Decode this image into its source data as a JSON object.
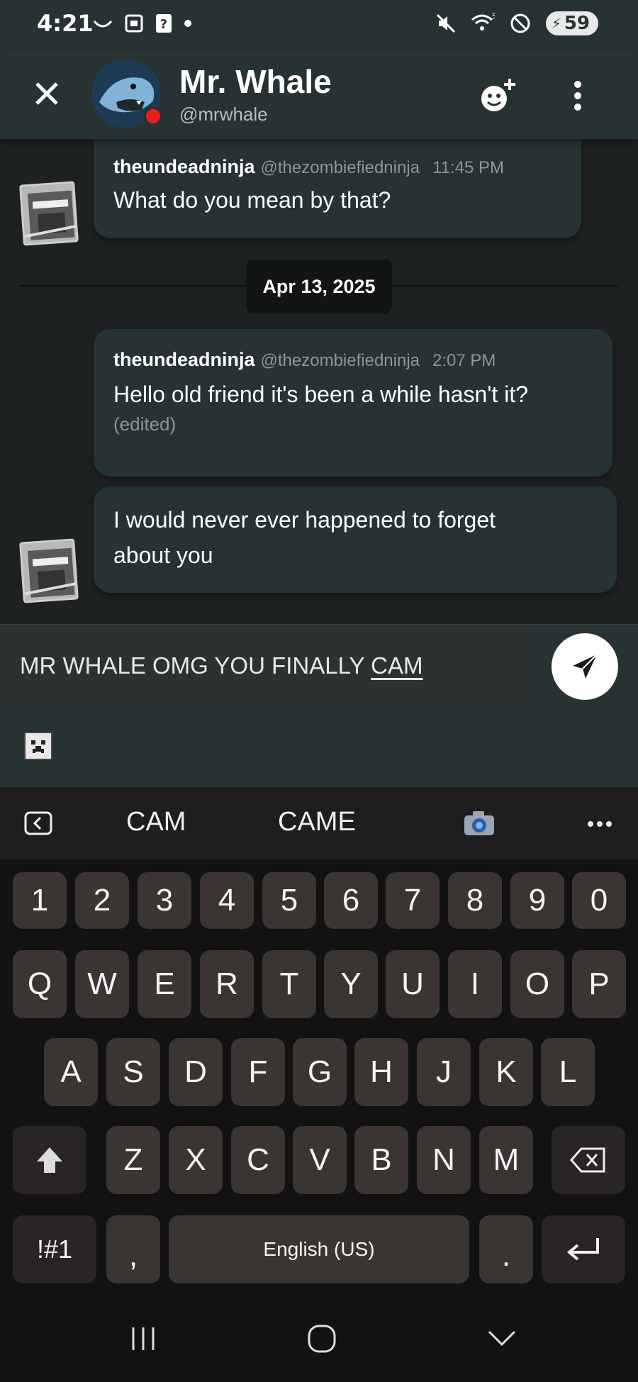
{
  "status_bar": {
    "time": "4:21",
    "battery": "59",
    "icons": [
      "missed-call-icon",
      "screenshot-icon",
      "notification-icon",
      "dot-icon",
      "mute-icon",
      "wifi-icon",
      "dnd-icon",
      "battery-icon"
    ]
  },
  "header": {
    "name": "Mr. Whale",
    "handle": "@mrwhale"
  },
  "messages": [
    {
      "author": "theundeadninja",
      "handle": "@thezombiefiedninja",
      "time": "11:45 PM",
      "text": "What do you mean by that?"
    },
    {
      "author": "theundeadninja",
      "handle": "@thezombiefiedninja",
      "time": "2:07 PM",
      "text": "Hello old friend it's been a while hasn't it?",
      "edited": "(edited)"
    },
    {
      "text_line1": "I would never ever happened to forget",
      "text_line2": "about you"
    }
  ],
  "date_divider": "Apr 13, 2025",
  "composer": {
    "text_prefix": "MR WHALE OMG YOU FINALLY ",
    "text_underlined": "CAM"
  },
  "keyboard": {
    "suggestions": [
      "CAM",
      "CAME"
    ],
    "number_row": [
      "1",
      "2",
      "3",
      "4",
      "5",
      "6",
      "7",
      "8",
      "9",
      "0"
    ],
    "row1": [
      "Q",
      "W",
      "E",
      "R",
      "T",
      "Y",
      "U",
      "I",
      "O",
      "P"
    ],
    "row2": [
      "A",
      "S",
      "D",
      "F",
      "G",
      "H",
      "J",
      "K",
      "L"
    ],
    "row3": [
      "Z",
      "X",
      "C",
      "V",
      "B",
      "N",
      "M"
    ],
    "symbols_key": "!#1",
    "comma_key": ",",
    "space_label": "English (US)",
    "period_key": "."
  },
  "colors": {
    "header_bg": "#273233",
    "chat_bg": "#1e2121",
    "bubble_bg": "#273233",
    "status_red": "#e81e1e",
    "key_bg": "#3a3533"
  }
}
